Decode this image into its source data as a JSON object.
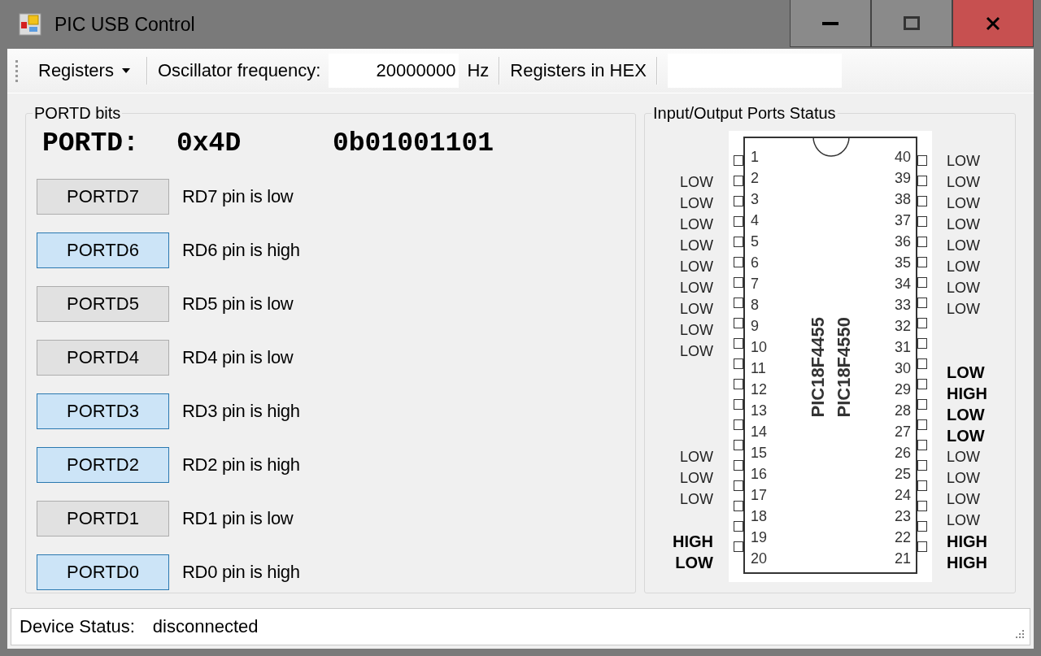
{
  "window": {
    "title": "PIC USB Control"
  },
  "toolbar": {
    "registers_menu": "Registers",
    "oscillator_label": "Oscillator frequency:",
    "oscillator_value": "20000000",
    "oscillator_unit": "Hz",
    "hex_label": "Registers in HEX"
  },
  "portd_group": {
    "title": "PORTD bits",
    "register_name": "PORTD:",
    "hex_value": "0x4D",
    "binary_value": "0b01001101",
    "bits": [
      {
        "label": "PORTD7",
        "status": "RD7 pin is low",
        "on": false
      },
      {
        "label": "PORTD6",
        "status": "RD6 pin is high",
        "on": true
      },
      {
        "label": "PORTD5",
        "status": "RD5 pin is low",
        "on": false
      },
      {
        "label": "PORTD4",
        "status": "RD4 pin is low",
        "on": false
      },
      {
        "label": "PORTD3",
        "status": "RD3 pin is high",
        "on": true
      },
      {
        "label": "PORTD2",
        "status": "RD2 pin is high",
        "on": true
      },
      {
        "label": "PORTD1",
        "status": "RD1 pin is low",
        "on": false
      },
      {
        "label": "PORTD0",
        "status": "RD0 pin is high",
        "on": true
      }
    ]
  },
  "ports_group": {
    "title": "Input/Output Ports Status",
    "chip_names": [
      "PIC18F4455",
      "PIC18F4550"
    ],
    "left_pins": [
      {
        "number": "1"
      },
      {
        "number": "2",
        "status": "LOW",
        "emphasized": false
      },
      {
        "number": "3",
        "status": "LOW",
        "emphasized": false
      },
      {
        "number": "4",
        "status": "LOW",
        "emphasized": false
      },
      {
        "number": "5",
        "status": "LOW",
        "emphasized": false
      },
      {
        "number": "6",
        "status": "LOW",
        "emphasized": false
      },
      {
        "number": "7",
        "status": "LOW",
        "emphasized": false
      },
      {
        "number": "8",
        "status": "LOW",
        "emphasized": false
      },
      {
        "number": "9",
        "status": "LOW",
        "emphasized": false
      },
      {
        "number": "10",
        "status": "LOW",
        "emphasized": false
      },
      {
        "number": "11"
      },
      {
        "number": "12"
      },
      {
        "number": "13"
      },
      {
        "number": "14"
      },
      {
        "number": "15",
        "status": "LOW",
        "emphasized": false
      },
      {
        "number": "16",
        "status": "LOW",
        "emphasized": false
      },
      {
        "number": "17",
        "status": "LOW",
        "emphasized": false
      },
      {
        "number": "18"
      },
      {
        "number": "19",
        "status": "HIGH",
        "emphasized": true
      },
      {
        "number": "20",
        "status": "LOW",
        "emphasized": true
      }
    ],
    "right_pins": [
      {
        "number": "40",
        "status": "LOW",
        "emphasized": false
      },
      {
        "number": "39",
        "status": "LOW",
        "emphasized": false
      },
      {
        "number": "38",
        "status": "LOW",
        "emphasized": false
      },
      {
        "number": "37",
        "status": "LOW",
        "emphasized": false
      },
      {
        "number": "36",
        "status": "LOW",
        "emphasized": false
      },
      {
        "number": "35",
        "status": "LOW",
        "emphasized": false
      },
      {
        "number": "34",
        "status": "LOW",
        "emphasized": false
      },
      {
        "number": "33",
        "status": "LOW",
        "emphasized": false
      },
      {
        "number": "32"
      },
      {
        "number": "31"
      },
      {
        "number": "30",
        "status": "LOW",
        "emphasized": true
      },
      {
        "number": "29",
        "status": "HIGH",
        "emphasized": true
      },
      {
        "number": "28",
        "status": "LOW",
        "emphasized": true
      },
      {
        "number": "27",
        "status": "LOW",
        "emphasized": true
      },
      {
        "number": "26",
        "status": "LOW",
        "emphasized": false
      },
      {
        "number": "25",
        "status": "LOW",
        "emphasized": false
      },
      {
        "number": "24",
        "status": "LOW",
        "emphasized": false
      },
      {
        "number": "23",
        "status": "LOW",
        "emphasized": false
      },
      {
        "number": "22",
        "status": "HIGH",
        "emphasized": true
      },
      {
        "number": "21",
        "status": "HIGH",
        "emphasized": true
      }
    ]
  },
  "status_bar": {
    "label": "Device Status:",
    "value": "disconnected"
  }
}
